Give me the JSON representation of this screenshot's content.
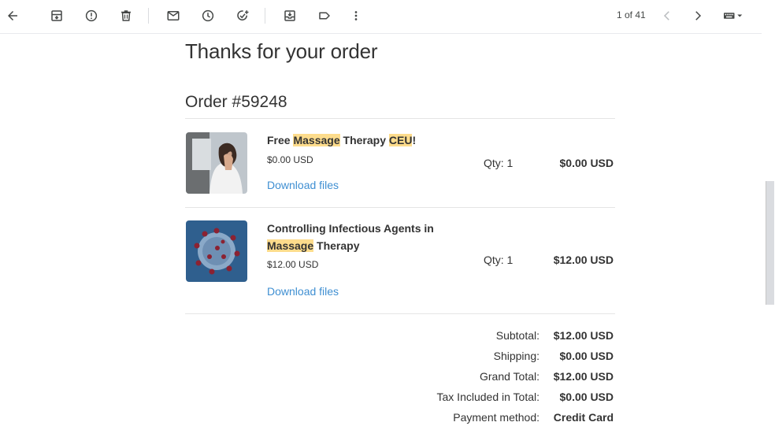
{
  "toolbar": {
    "pager_count": "1 of 41",
    "icons": [
      "back-arrow-icon",
      "archive-icon",
      "report-spam-icon",
      "delete-icon",
      "mark-unread-icon",
      "snooze-icon",
      "add-task-icon",
      "move-to-icon",
      "label-icon",
      "more-vert-icon",
      "chevron-left-icon",
      "chevron-right-icon",
      "keyboard-icon"
    ]
  },
  "email": {
    "heading": "Thanks for your order",
    "order_title": "Order #59248",
    "items": [
      {
        "title_parts": [
          "Free ",
          "Massage",
          " Therapy ",
          "CEU",
          "!"
        ],
        "price": "$0.00 USD",
        "download": "Download files",
        "qty": "Qty: 1",
        "total": "$0.00 USD"
      },
      {
        "title_parts": [
          "Controlling Infectious Agents in ",
          "Massage",
          " Therapy"
        ],
        "price": "$12.00 USD",
        "download": "Download files",
        "qty": "Qty: 1",
        "total": "$12.00 USD"
      }
    ],
    "summary": [
      {
        "label": "Subtotal:",
        "value": "$12.00 USD"
      },
      {
        "label": "Shipping:",
        "value": "$0.00 USD"
      },
      {
        "label": "Grand Total:",
        "value": "$12.00 USD"
      },
      {
        "label": "Tax Included in Total:",
        "value": "$0.00 USD"
      },
      {
        "label": "Payment method:",
        "value": "Credit Card"
      }
    ]
  },
  "colors": {
    "highlight": "#fddc8c",
    "link": "#3f8fd2"
  }
}
